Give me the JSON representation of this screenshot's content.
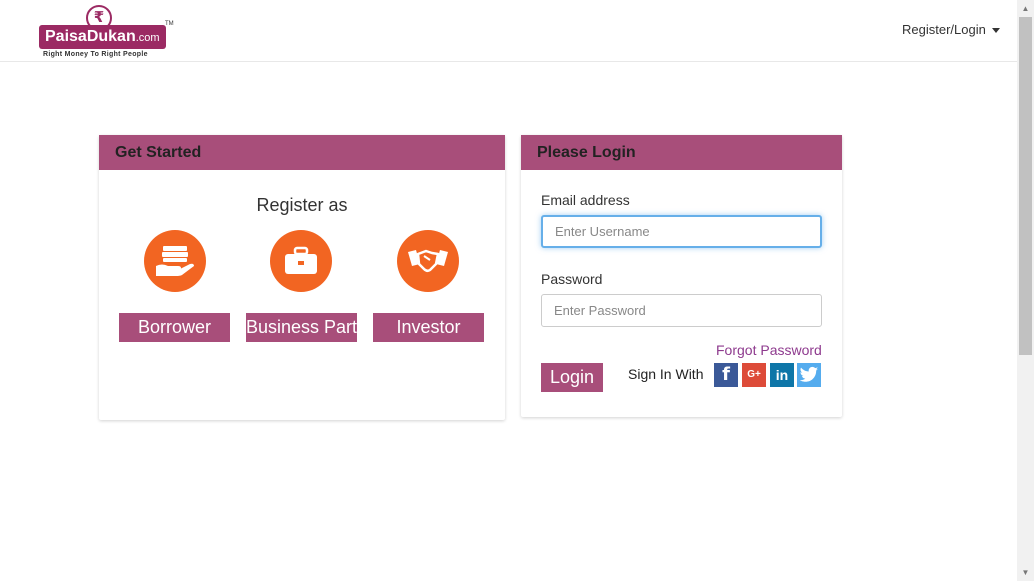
{
  "header": {
    "logo": {
      "brand_name": "PaisaDukan",
      "brand_suffix": ".com",
      "tagline": "Right Money To Right People",
      "tm": "TM",
      "currency_symbol": "₹"
    },
    "register_login_label": "Register/Login"
  },
  "get_started": {
    "title": "Get Started",
    "register_as": "Register as",
    "options": [
      {
        "label": "Borrower",
        "icon": "money-in-hand-icon"
      },
      {
        "label": "Business Partner",
        "icon": "briefcase-icon"
      },
      {
        "label": "Investor",
        "icon": "handshake-icon"
      }
    ]
  },
  "login": {
    "title": "Please Login",
    "email_label": "Email address",
    "email_placeholder": "Enter Username",
    "email_value": "",
    "password_label": "Password",
    "password_placeholder": "Enter Password",
    "password_value": "",
    "forgot_password": "Forgot Password",
    "login_button": "Login",
    "sign_in_with": "Sign In With",
    "social": [
      {
        "name": "facebook-icon",
        "glyph": "f"
      },
      {
        "name": "google-plus-icon",
        "glyph": "G+"
      },
      {
        "name": "linkedin-icon",
        "glyph": "in"
      },
      {
        "name": "twitter-icon",
        "glyph": ""
      }
    ]
  },
  "colors": {
    "brand": "#a84e7a",
    "icon_orange": "#f26522",
    "focus": "#66afe9",
    "link": "#8e3a8e"
  }
}
